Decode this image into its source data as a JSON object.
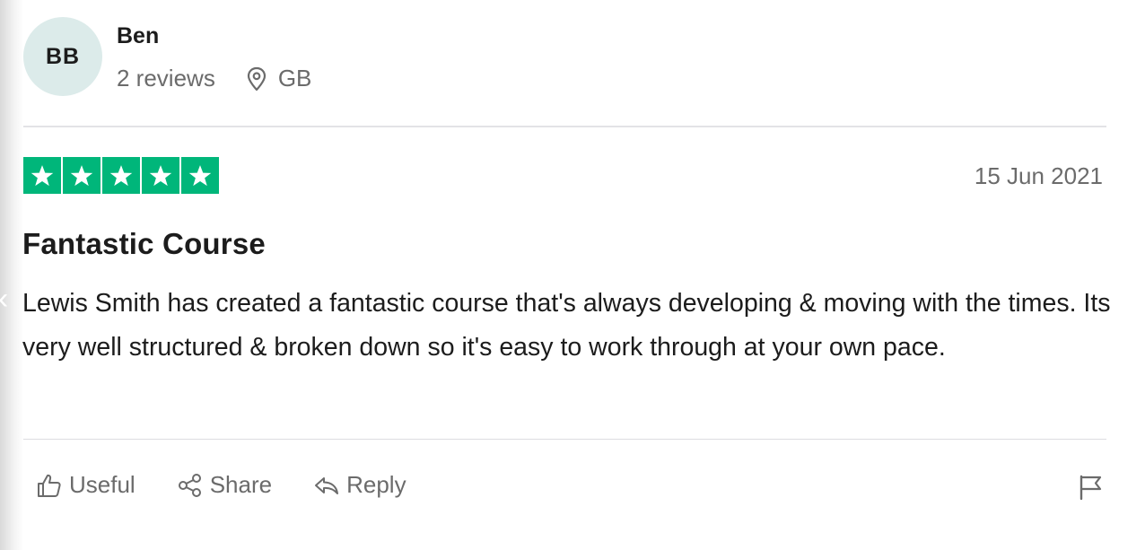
{
  "reviewer": {
    "initials": "BB",
    "name": "Ben",
    "review_count": "2 reviews",
    "country": "GB"
  },
  "review": {
    "rating": 5,
    "rating_max": 5,
    "date": "15 Jun 2021",
    "title": "Fantastic Course",
    "body": "Lewis Smith has created a fantastic course that's always developing & moving with the times. Its very well structured & broken down so it's easy to work through at your own pace."
  },
  "actions": {
    "useful_label": "Useful",
    "share_label": "Share",
    "reply_label": "Reply"
  },
  "icons": {
    "location": "location-pin-icon",
    "useful": "thumbs-up-icon",
    "share": "share-icon",
    "reply": "reply-icon",
    "flag": "flag-icon",
    "star": "star-icon"
  },
  "colors": {
    "star_green": "#00b67a",
    "avatar_bg": "#dcebea",
    "muted_text": "#6b6b6b",
    "primary_text": "#1c1c1c"
  }
}
